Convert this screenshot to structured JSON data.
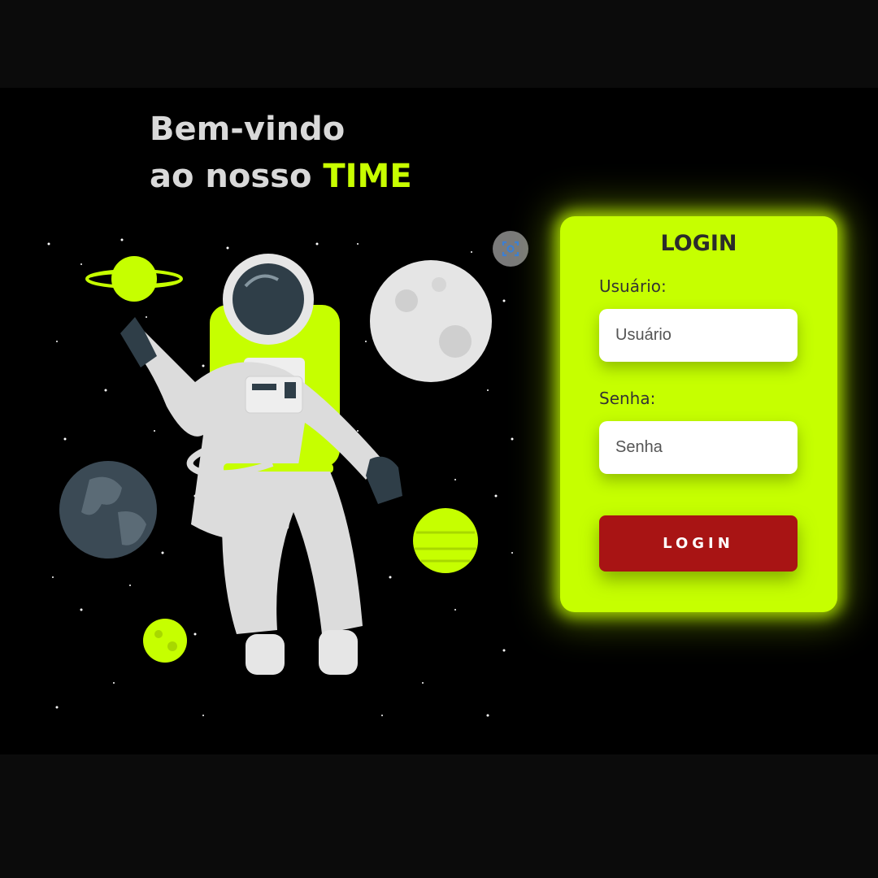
{
  "hero": {
    "line1": "Bem-vindo",
    "line2_prefix": "ao nosso ",
    "line2_accent": "TIME"
  },
  "illustration": {
    "subject": "astronaut-in-space",
    "lens_icon": "image-search-icon"
  },
  "login": {
    "title": "LOGIN",
    "username_label": "Usuário:",
    "username_placeholder": "Usuário",
    "password_label": "Senha:",
    "password_placeholder": "Senha",
    "submit_label": "LOGIN"
  },
  "colors": {
    "accent": "#c6ff00",
    "background": "#000000",
    "button": "#a81414"
  }
}
